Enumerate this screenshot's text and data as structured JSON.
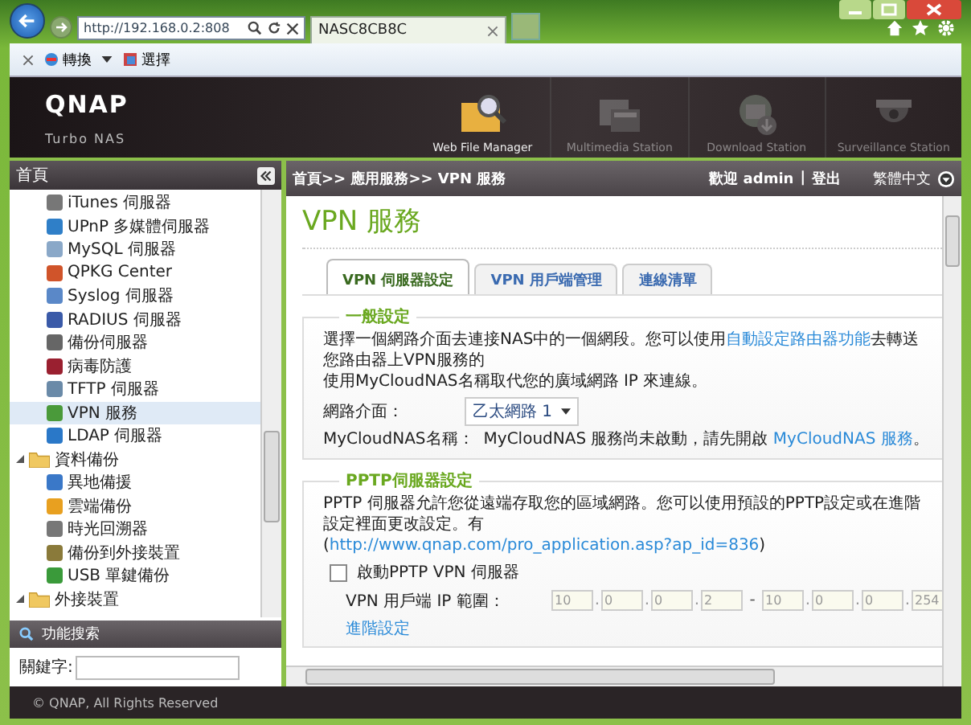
{
  "browser": {
    "address": "http://192.168.0.2:808",
    "tab_title": "NASC8CB8C",
    "toolbar": [
      {
        "label": "轉換",
        "kind": "convert"
      },
      {
        "label": "選擇",
        "kind": "select"
      }
    ]
  },
  "header": {
    "logo": "QNAP",
    "subtitle": "Turbo NAS",
    "apps": [
      {
        "label": "Web File Manager",
        "kind": "files",
        "disabled": false
      },
      {
        "label": "Multimedia Station",
        "kind": "media",
        "disabled": true
      },
      {
        "label": "Download Station",
        "kind": "download",
        "disabled": true
      },
      {
        "label": "Surveillance Station",
        "kind": "camera",
        "disabled": true
      }
    ]
  },
  "sidebar": {
    "title": "首頁",
    "items": [
      {
        "label": "iTunes 伺服器",
        "color": "#777777",
        "selected": false
      },
      {
        "label": "UPnP 多媒體伺服器",
        "color": "#2f7fc8",
        "selected": false
      },
      {
        "label": "MySQL 伺服器",
        "color": "#8aa8c8",
        "selected": false
      },
      {
        "label": "QPKG Center",
        "color": "#d0542a",
        "selected": false
      },
      {
        "label": "Syslog 伺服器",
        "color": "#5a88c8",
        "selected": false
      },
      {
        "label": "RADIUS 伺服器",
        "color": "#3a5aa8",
        "selected": false
      },
      {
        "label": "備份伺服器",
        "color": "#666666",
        "selected": false
      },
      {
        "label": "病毒防護",
        "color": "#9a2030",
        "selected": false
      },
      {
        "label": "TFTP 伺服器",
        "color": "#6a8aa8",
        "selected": false
      },
      {
        "label": "VPN 服務",
        "color": "#4a9a3a",
        "selected": true
      },
      {
        "label": "LDAP 伺服器",
        "color": "#2a78c8",
        "selected": false
      },
      {
        "label": "資料備份",
        "expanded": true,
        "selected": false,
        "children": [
          {
            "label": "異地備援",
            "color": "#3a78c8",
            "selected": false
          },
          {
            "label": "雲端備份",
            "color": "#e8a020",
            "selected": false
          },
          {
            "label": "時光回溯器",
            "color": "#777777",
            "selected": false
          },
          {
            "label": "備份到外接裝置",
            "color": "#8a7a3a",
            "selected": false
          },
          {
            "label": "USB 單鍵備份",
            "color": "#3a9a3a",
            "selected": false
          }
        ]
      },
      {
        "label": "外接裝置",
        "expanded": true,
        "selected": false
      }
    ],
    "search": {
      "title": "功能搜索",
      "label": "關鍵字:"
    }
  },
  "topbar": {
    "breadcrumb": "首頁>> 應用服務>> VPN 服務",
    "welcome": "歡迎 admin",
    "divider": "|",
    "logout": "登出",
    "language": "繁體中文"
  },
  "page": {
    "title": "VPN 服務",
    "tabs": [
      {
        "label": "VPN 伺服器設定",
        "selected": true
      },
      {
        "label": "VPN 用戶端管理",
        "selected": false
      },
      {
        "label": "連線清單",
        "selected": false
      }
    ],
    "general": {
      "legend": "一般設定",
      "text_before": "選擇一個網路介面去連接NAS中的一個網段。您可以使用",
      "link": "自動設定路由器功能",
      "text_after": "去轉送您路由器上VPN服務的",
      "text_line_2": "使用MyCloudNAS名稱取代您的廣域網路 IP 來連線。",
      "interface_label": "網路介面：",
      "interface_value": "乙太網路 1",
      "name_label": "MyCloudNAS名稱：",
      "name_text": "MyCloudNAS 服務尚未啟動，請先開啟 ",
      "name_link": "MyCloudNAS 服務",
      "name_end": "。"
    },
    "pptp": {
      "legend": "PPTP伺服器設定",
      "text": "PPTP 伺服器允許您從遠端存取您的區域網路。您可以使用預設的PPTP設定或在進階設定裡面更改設定。有",
      "link_open": "(",
      "link": "http://www.qnap.com/pro_application.asp?ap_id=836",
      "link_close": ")",
      "enable_label": "啟動PPTP VPN 伺服器",
      "enabled": false,
      "range_label": "VPN 用戶端 IP 範圍：",
      "ip_disabled": true,
      "ip_start": [
        "10",
        "0",
        "0",
        "2"
      ],
      "ip_end": [
        "10",
        "0",
        "0",
        "254"
      ],
      "dot": ".",
      "dash": "-",
      "advanced": "進階設定"
    }
  },
  "footer": "© QNAP, All Rights Reserved"
}
